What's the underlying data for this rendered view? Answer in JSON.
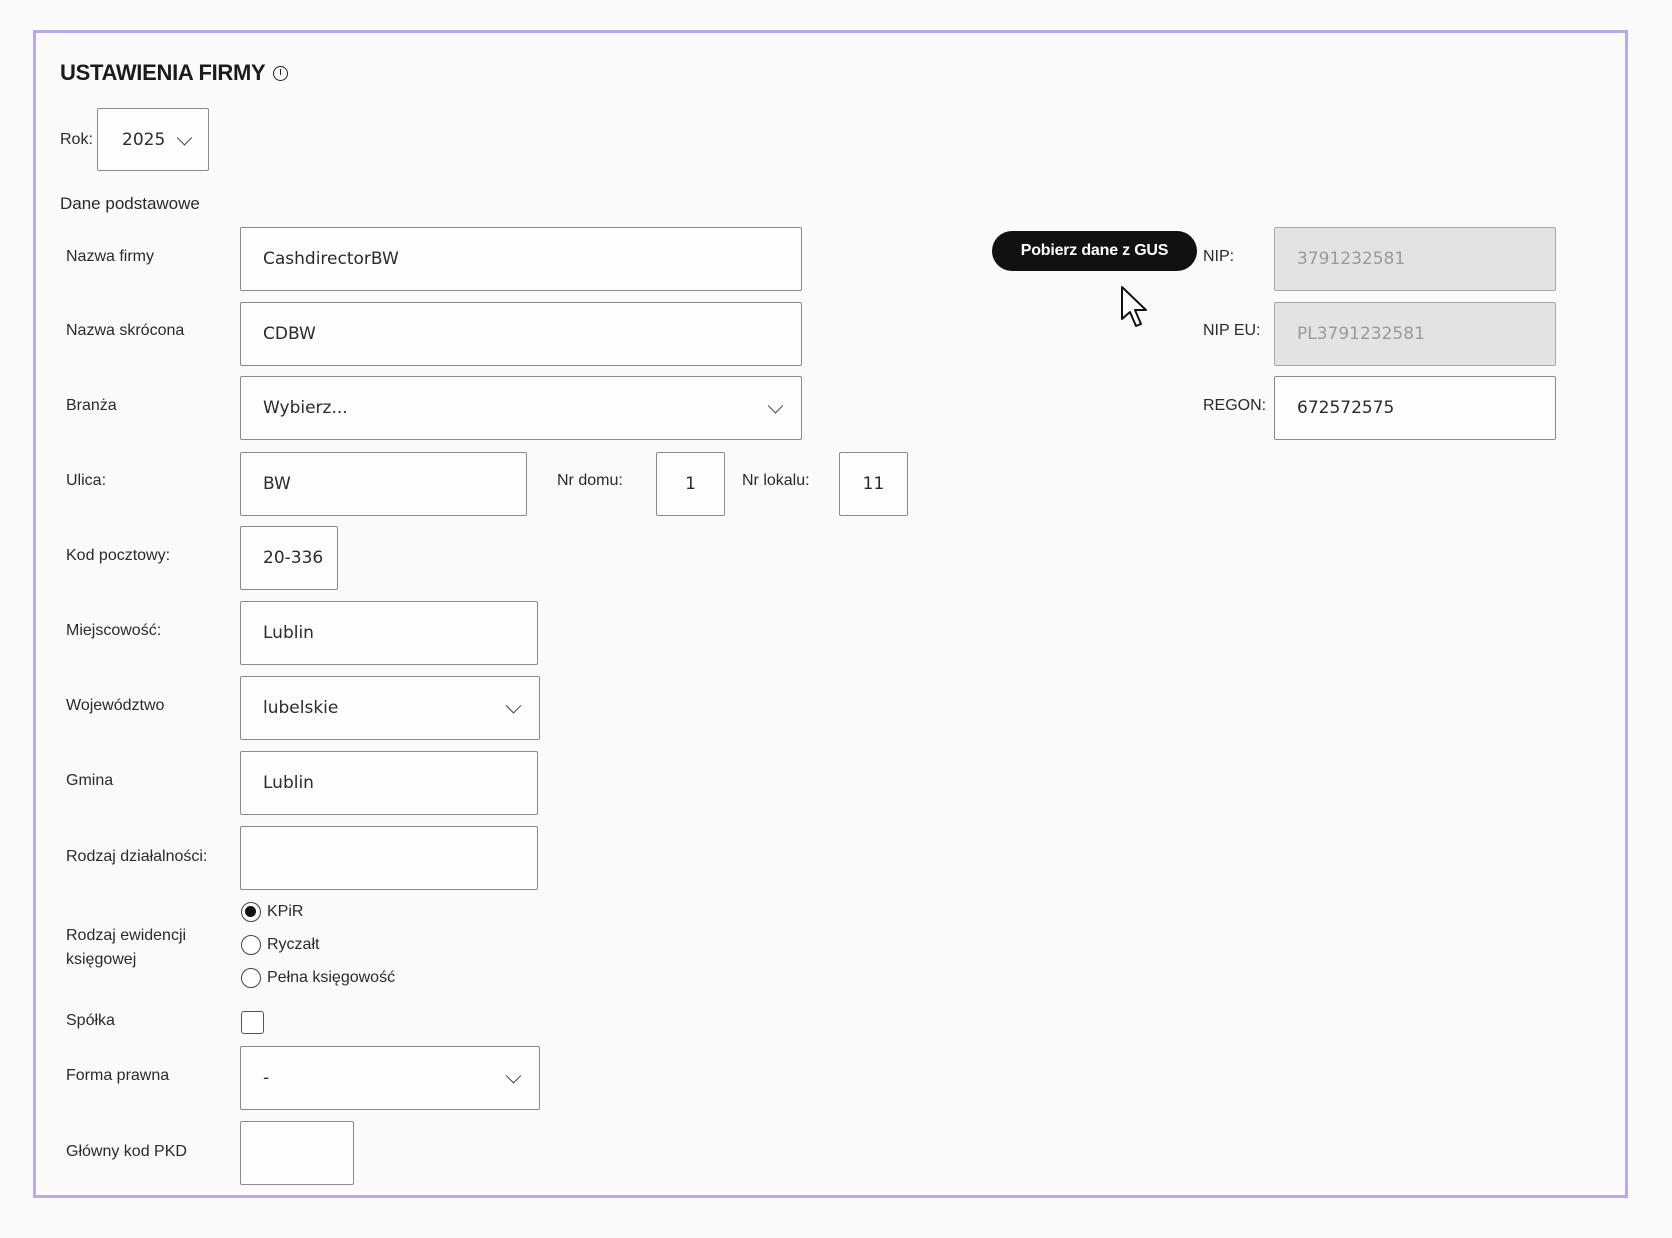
{
  "header": {
    "title": "USTAWIENIA FIRMY",
    "year_label": "Rok:",
    "year_value": "2025"
  },
  "section": {
    "basic_data": "Dane podstawowe"
  },
  "form": {
    "company_name": {
      "label": "Nazwa firmy",
      "value": "CashdirectorBW"
    },
    "short_name": {
      "label": "Nazwa skrócona",
      "value": "CDBW"
    },
    "industry": {
      "label": "Branża",
      "value": "Wybierz..."
    },
    "street": {
      "label": "Ulica:",
      "value": "BW"
    },
    "house_no": {
      "label": "Nr domu:",
      "value": "1"
    },
    "flat_no": {
      "label": "Nr lokalu:",
      "value": "11"
    },
    "postal_code": {
      "label": "Kod pocztowy:",
      "value": "20-336"
    },
    "city": {
      "label": "Miejscowość:",
      "value": "Lublin"
    },
    "province": {
      "label": "Województwo",
      "value": "lubelskie"
    },
    "commune": {
      "label": "Gmina",
      "value": "Lublin"
    },
    "activity_type": {
      "label": "Rodzaj działalności:",
      "value": ""
    },
    "accounting_type": {
      "label_line1": "Rodzaj ewidencji",
      "label_line2": "księgowej",
      "options": [
        "KPiR",
        "Ryczałt",
        "Pełna księgowość"
      ],
      "selected": "KPiR"
    },
    "partnership": {
      "label": "Spółka",
      "checked": false
    },
    "legal_form": {
      "label": "Forma prawna",
      "value": "-"
    },
    "pkd": {
      "label": "Główny kod PKD",
      "value": ""
    }
  },
  "tax": {
    "gus_button": "Pobierz dane z GUS",
    "nip": {
      "label": "NIP:",
      "value": "3791232581"
    },
    "nip_eu": {
      "label": "NIP EU:",
      "value": "PL3791232581"
    },
    "regon": {
      "label": "REGON:",
      "value": "672572575"
    }
  },
  "colors": {
    "frame_border": "#b9aaf0",
    "button_bg": "#111111",
    "disabled_bg": "#e3e3e3"
  }
}
